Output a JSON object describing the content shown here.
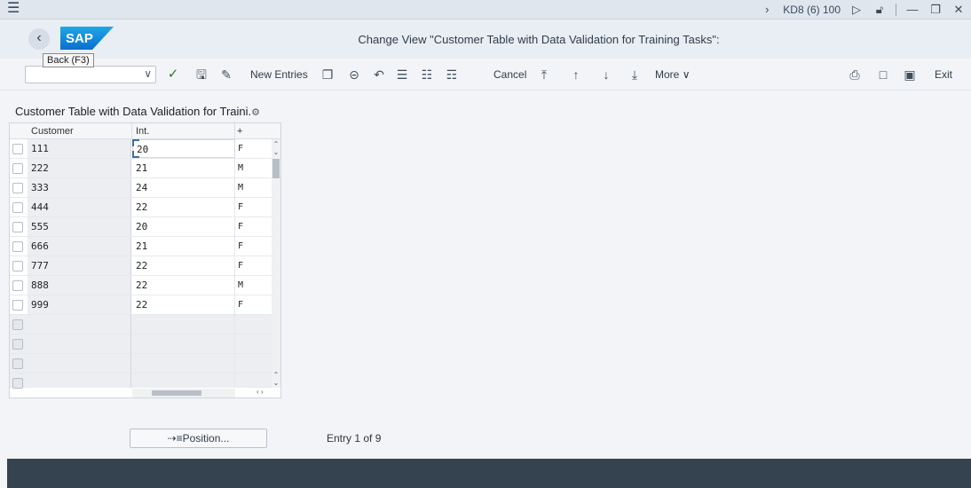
{
  "system_bar": {
    "system_id": "KD8 (6) 100"
  },
  "titlebar": {
    "title": "Change View \"Customer Table with Data Validation for Training Tasks\":",
    "back_tooltip": "Back  (F3)",
    "logo": "SAP"
  },
  "toolbar": {
    "new_entries": "New Entries",
    "cancel": "Cancel",
    "more": "More",
    "exit": "Exit"
  },
  "table": {
    "title": "Customer Table with Data Validation for Traini.",
    "headers": {
      "customer": "Customer",
      "int": "Int.",
      "col3": "+"
    },
    "rows": [
      {
        "customer": "111",
        "int": "20",
        "g": "F"
      },
      {
        "customer": "222",
        "int": "21",
        "g": "M"
      },
      {
        "customer": "333",
        "int": "24",
        "g": "M"
      },
      {
        "customer": "444",
        "int": "22",
        "g": "F"
      },
      {
        "customer": "555",
        "int": "20",
        "g": "F"
      },
      {
        "customer": "666",
        "int": "21",
        "g": "F"
      },
      {
        "customer": "777",
        "int": "22",
        "g": "F"
      },
      {
        "customer": "888",
        "int": "22",
        "g": "M"
      },
      {
        "customer": "999",
        "int": "22",
        "g": "F"
      }
    ]
  },
  "footer": {
    "position_button": "Position...",
    "entry_info": "Entry 1 of 9"
  },
  "colors": {
    "accent": "#0a6ed1",
    "footer_bg": "#354250"
  }
}
